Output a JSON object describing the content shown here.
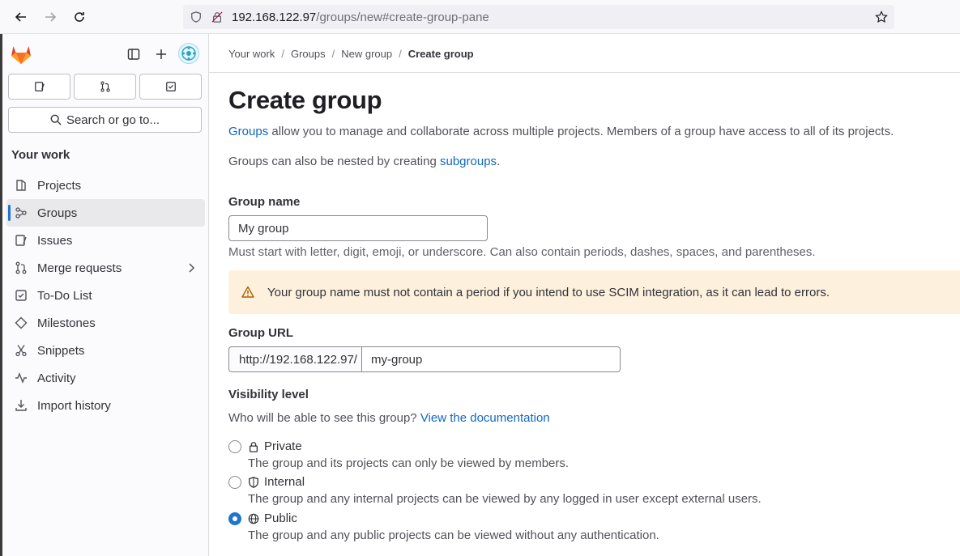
{
  "browser": {
    "url_host": "192.168.122.97",
    "url_path": "/groups/new#create-group-pane"
  },
  "sidebar": {
    "search_label": "Search or go to...",
    "section_title": "Your work",
    "items": [
      {
        "label": "Projects",
        "icon": "project-icon"
      },
      {
        "label": "Groups",
        "icon": "group-icon",
        "active": true
      },
      {
        "label": "Issues",
        "icon": "issues-icon"
      },
      {
        "label": "Merge requests",
        "icon": "merge-request-icon"
      },
      {
        "label": "To-Do List",
        "icon": "todo-icon"
      },
      {
        "label": "Milestones",
        "icon": "milestone-icon"
      },
      {
        "label": "Snippets",
        "icon": "snippet-icon"
      },
      {
        "label": "Activity",
        "icon": "activity-icon"
      },
      {
        "label": "Import history",
        "icon": "import-icon"
      }
    ]
  },
  "breadcrumb": [
    "Your work",
    "Groups",
    "New group",
    "Create group"
  ],
  "page": {
    "title": "Create group",
    "desc1_link": "Groups",
    "desc1_text": " allow you to manage and collaborate across multiple projects. Members of a group have access to all of its projects.",
    "desc2_text": "Groups can also be nested by creating ",
    "desc2_link": "subgroups",
    "desc2_end": "."
  },
  "form": {
    "group_name_label": "Group name",
    "group_name_value": "My group",
    "group_name_help": "Must start with letter, digit, emoji, or underscore. Can also contain periods, dashes, spaces, and parentheses.",
    "alert_text": "Your group name must not contain a period if you intend to use SCIM integration, as it can lead to errors.",
    "group_url_label": "Group URL",
    "url_prefix": "http://192.168.122.97/",
    "url_value": "my-group",
    "visibility_label": "Visibility level",
    "visibility_help": "Who will be able to see this group? ",
    "visibility_link": "View the documentation",
    "options": [
      {
        "label": "Private",
        "help": "The group and its projects can only be viewed by members.",
        "checked": false
      },
      {
        "label": "Internal",
        "help": "The group and any internal projects can be viewed by any logged in user except external users.",
        "checked": false
      },
      {
        "label": "Public",
        "help": "The group and any public projects can be viewed without any authentication.",
        "checked": true
      }
    ]
  },
  "colors": {
    "accent": "#1f75cb",
    "link": "#1068bf",
    "alert_bg": "#fdf1dd"
  }
}
